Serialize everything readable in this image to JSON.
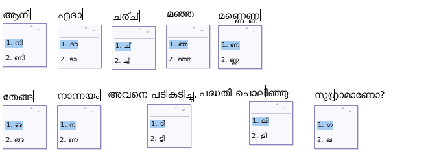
{
  "pager": {
    "up": "⌃",
    "down": "⌄"
  },
  "entries": [
    {
      "word": "ആനി",
      "c1": "1. നി",
      "c2": "2. ണി"
    },
    {
      "word": "എദാ",
      "c1": "1. ദാ",
      "c2": "2. ടാ"
    },
    {
      "word": "ചര്ച്",
      "c1": "1. ച്",
      "c2": "2. ച്ച്"
    },
    {
      "word": "മഞ്ഞ",
      "c1": "1. ഞ",
      "c2": "2. ഞ്ഞ"
    },
    {
      "word": "മണ്ണെണ്ണ",
      "c1": "1. ണ",
      "c2": "2. ണ്ണ"
    },
    {
      "word": "തേങ്ങ",
      "c1": "1. ങ",
      "c2": "2. ങ്ങ"
    },
    {
      "word": "നാന്നയം",
      "c1": "1. ന",
      "c2": "2. ണ"
    },
    {
      "word": "അവനെ പടികടിച്ചു.",
      "c1": "1. ടി",
      "c2": "2. ട്ടി"
    },
    {
      "word": "പദ്ധതി പൊലിഞ്ഞു",
      "c1": "1. ലി",
      "c2": "2. ളി"
    },
    {
      "word": "സുഗ്രാമാണോ?",
      "c1": "1. ഗ",
      "c2": "2. ഖ"
    }
  ]
}
